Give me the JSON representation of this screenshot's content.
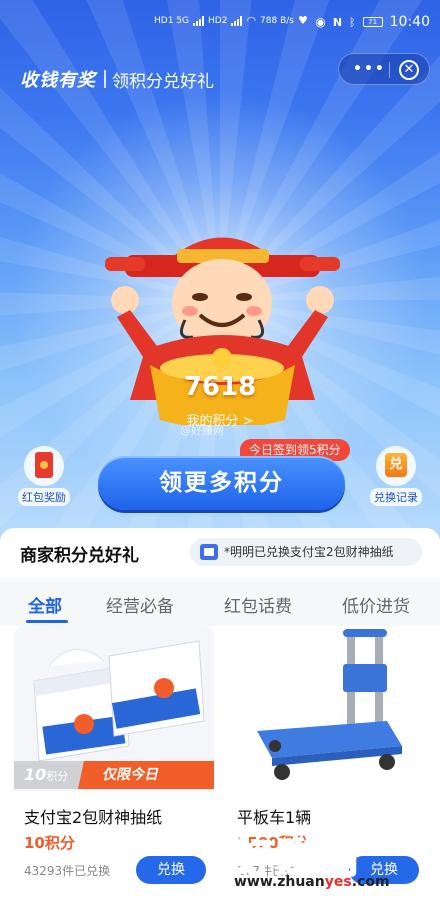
{
  "status_bar": {
    "net_left": "HD1 5G",
    "net_left2": "HD2",
    "speed": "788 B/s",
    "battery": "71",
    "time": "10:40"
  },
  "header": {
    "brand": "收钱有奖",
    "subtitle": "领积分兑好礼",
    "more_icon": "more-dots-icon",
    "close_icon": "close-circle-icon"
  },
  "hero": {
    "points_value": "7618",
    "points_label": "我的积分 >",
    "watermark_text": "@好赚网",
    "signin_tip": "今日签到领5积分",
    "cta_label": "领更多积分",
    "left_action": {
      "label": "红包奖励",
      "icon": "red-envelope-icon"
    },
    "right_action": {
      "label": "兑换记录",
      "icon": "exchange-record-icon",
      "glyph": "兑"
    }
  },
  "section": {
    "title": "商家积分兑好礼",
    "ticker": "*明明已兑换支付宝2包财神抽纸"
  },
  "tabs": [
    {
      "label": "全部",
      "active": true
    },
    {
      "label": "经营必备",
      "active": false
    },
    {
      "label": "红包话费",
      "active": false
    },
    {
      "label": "低价进货",
      "active": false
    }
  ],
  "products": [
    {
      "name": "支付宝2包财神抽纸",
      "price": "10积分",
      "tag_points": "10",
      "tag_points_unit": "积分",
      "tag_promo": "仅限今日",
      "sold": "43293件已兑换",
      "button": "兑换"
    },
    {
      "name": "平板车1辆",
      "price": "1500积分",
      "sold": "177件已兑换",
      "button": "兑换"
    }
  ],
  "watermark": {
    "big": "好赚网",
    "url_prefix": "www.zhuan",
    "url_mid": "yes",
    "url_suffix": ".com"
  },
  "colors": {
    "accent_blue": "#1f63e8",
    "promo_orange": "#f25e2a",
    "tip_red": "#f2473a"
  }
}
